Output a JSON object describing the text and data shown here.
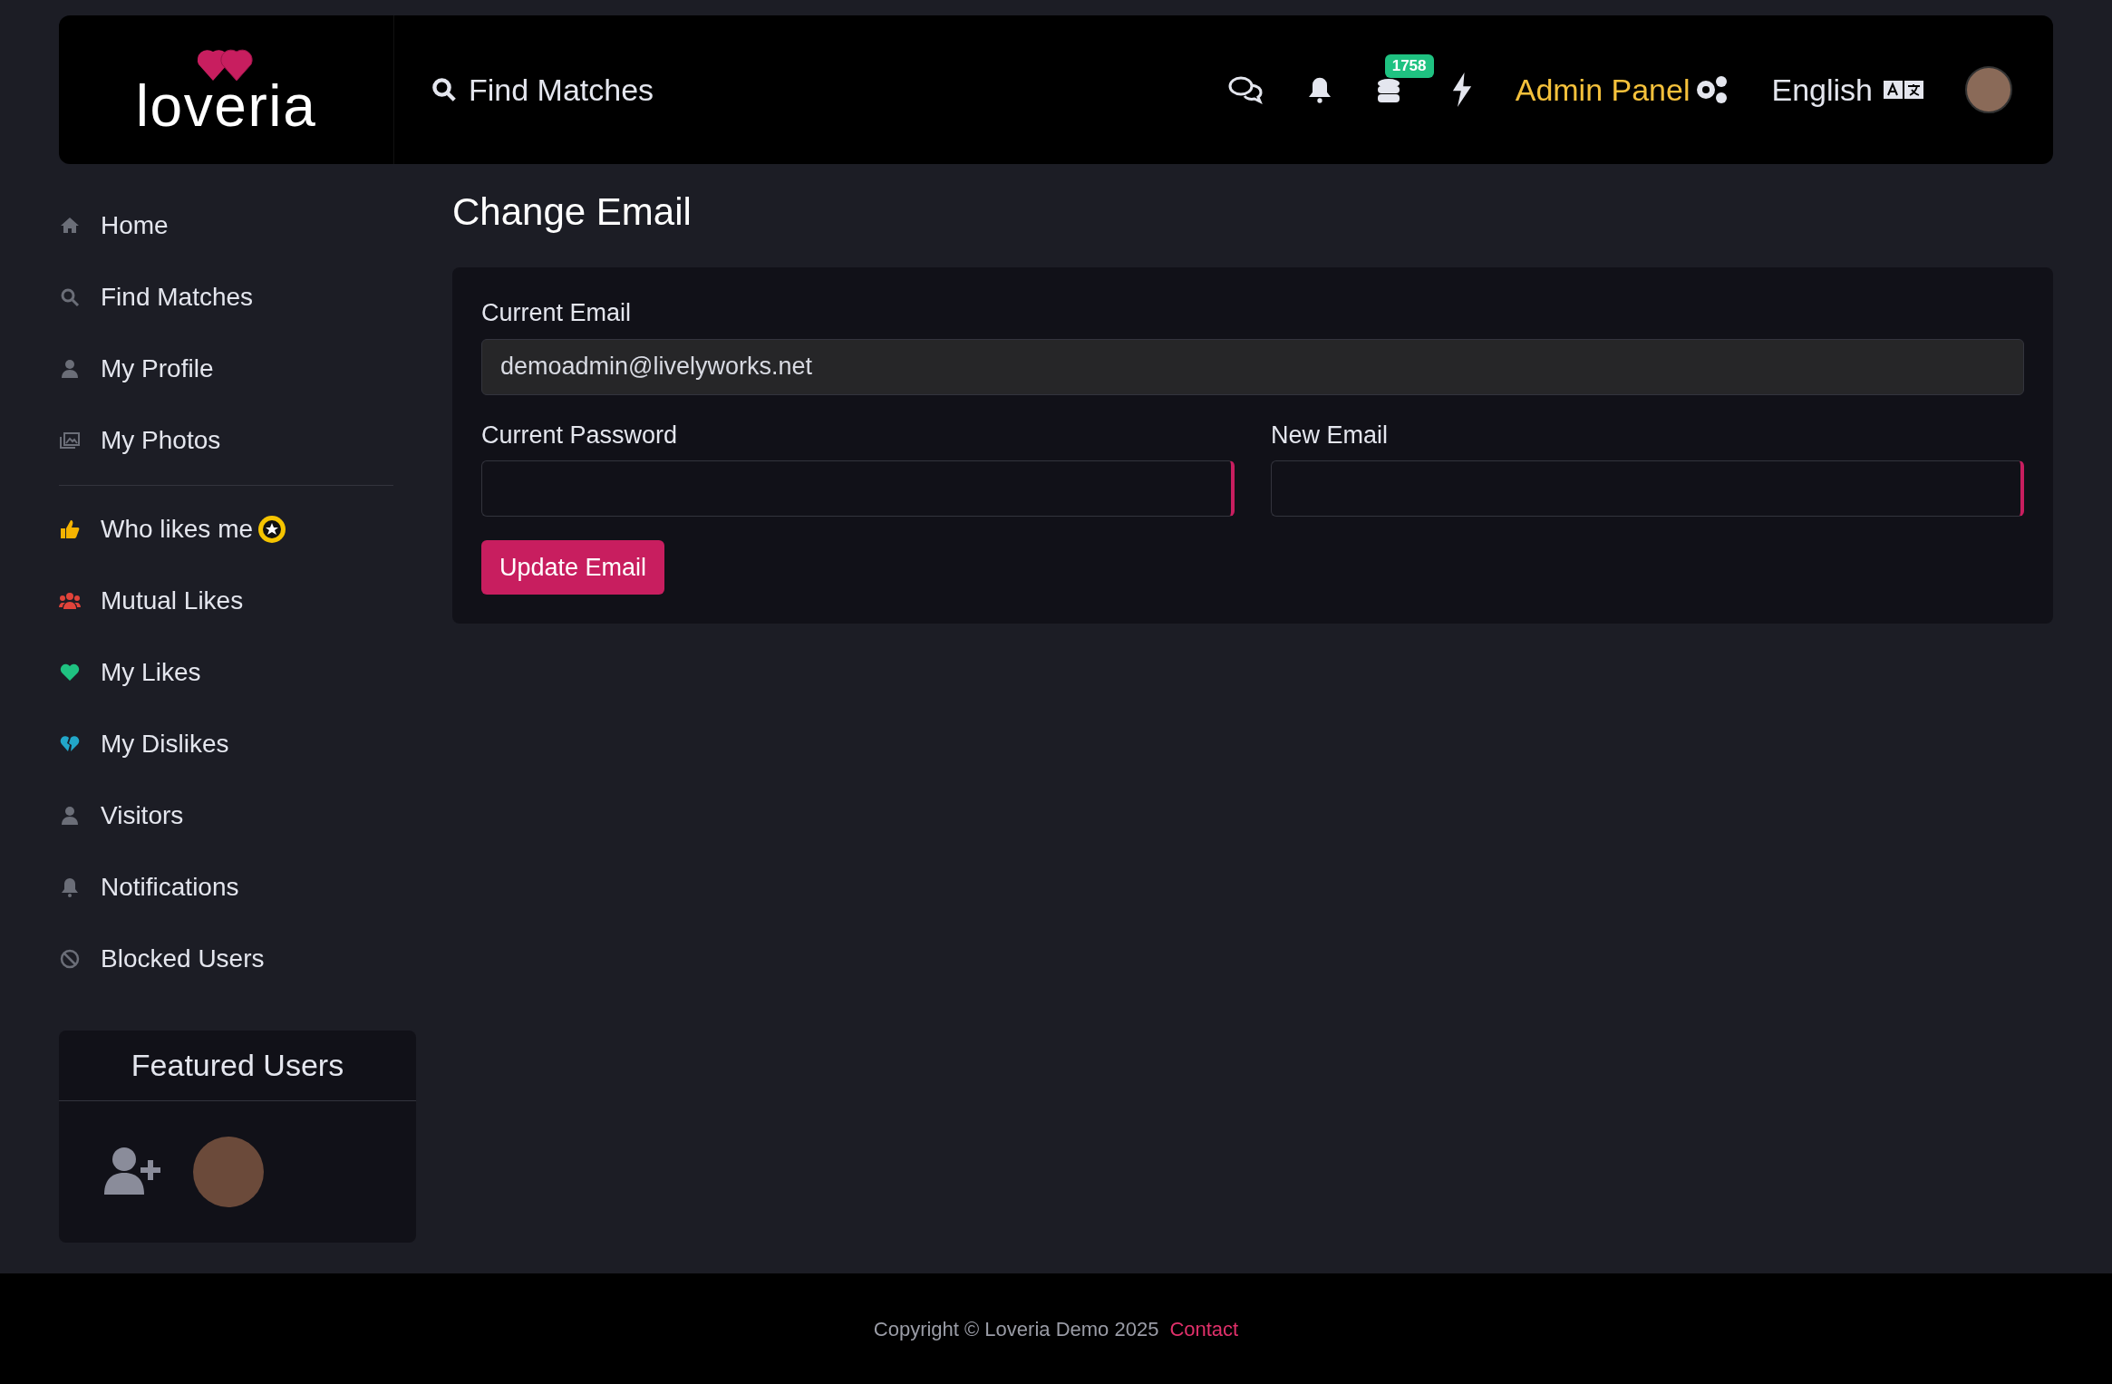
{
  "header": {
    "logo": "loveria",
    "search_link": "Find Matches",
    "coins_badge": "1758",
    "admin_link": "Admin Panel",
    "language": "English"
  },
  "sidebar": {
    "groups": [
      [
        {
          "label": "Home",
          "kind": "home",
          "color": "#6b6e78"
        },
        {
          "label": "Find Matches",
          "kind": "search",
          "color": "#6b6e78"
        },
        {
          "label": "My Profile",
          "kind": "user",
          "color": "#6b6e78"
        },
        {
          "label": "My Photos",
          "kind": "photos",
          "color": "#6b6e78"
        }
      ],
      [
        {
          "label": "Who likes me",
          "kind": "thumb",
          "color": "#f5b301",
          "badge": true
        },
        {
          "label": "Mutual Likes",
          "kind": "users",
          "color": "#e0433a",
          "badge": false
        },
        {
          "label": "My Likes",
          "kind": "heart",
          "color": "#1fc281",
          "badge": false
        },
        {
          "label": "My Dislikes",
          "kind": "dislike",
          "color": "#22a7c9",
          "badge": false
        },
        {
          "label": "Visitors",
          "kind": "user",
          "color": "#6b6e78",
          "badge": false
        },
        {
          "label": "Notifications",
          "kind": "bell",
          "color": "#6b6e78",
          "badge": false
        },
        {
          "label": "Blocked Users",
          "kind": "ban",
          "color": "#6b6e78",
          "badge": false
        }
      ]
    ]
  },
  "featured_users": {
    "title": "Featured Users"
  },
  "page": {
    "title": "Change Email",
    "current_email": {
      "label": "Current Email",
      "value": "demoadmin@livelyworks.net"
    },
    "current_password": {
      "label": "Current Password"
    },
    "new_email": {
      "label": "New Email"
    },
    "button": "Update Email"
  },
  "footer": {
    "copyright": "Copyright © Loveria Demo 2025",
    "link": "Contact"
  }
}
